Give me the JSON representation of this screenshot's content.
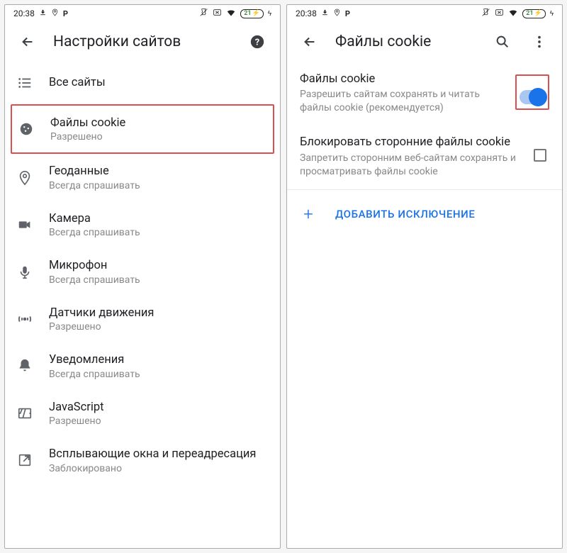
{
  "statusbar": {
    "time": "20:38",
    "battery": "21"
  },
  "left": {
    "title": "Настройки сайтов",
    "items": [
      {
        "icon": "list",
        "label": "Все сайты",
        "sub": ""
      },
      {
        "icon": "cookie",
        "label": "Файлы cookie",
        "sub": "Разрешено"
      },
      {
        "icon": "location",
        "label": "Геоданные",
        "sub": "Всегда спрашивать"
      },
      {
        "icon": "camera",
        "label": "Камера",
        "sub": "Всегда спрашивать"
      },
      {
        "icon": "mic",
        "label": "Микрофон",
        "sub": "Всегда спрашивать"
      },
      {
        "icon": "motion",
        "label": "Датчики движения",
        "sub": "Разрешено"
      },
      {
        "icon": "bell",
        "label": "Уведомления",
        "sub": "Всегда спрашивать"
      },
      {
        "icon": "js",
        "label": "JavaScript",
        "sub": "Разрешено"
      },
      {
        "icon": "popup",
        "label": "Всплывающие окна и переадресация",
        "sub": "Заблокировано"
      }
    ]
  },
  "right": {
    "title": "Файлы cookie",
    "cookies": {
      "label": "Файлы cookie",
      "sub": "Разрешить сайтам сохранять и читать файлы cookie (рекомендуется)",
      "enabled": true
    },
    "block3p": {
      "label": "Блокировать сторонние файлы cookie",
      "sub": "Запретить сторонним веб-сайтам сохранять и просматривать файлы cookie",
      "checked": false
    },
    "add": "ДОБАВИТЬ ИСКЛЮЧЕНИЕ"
  }
}
